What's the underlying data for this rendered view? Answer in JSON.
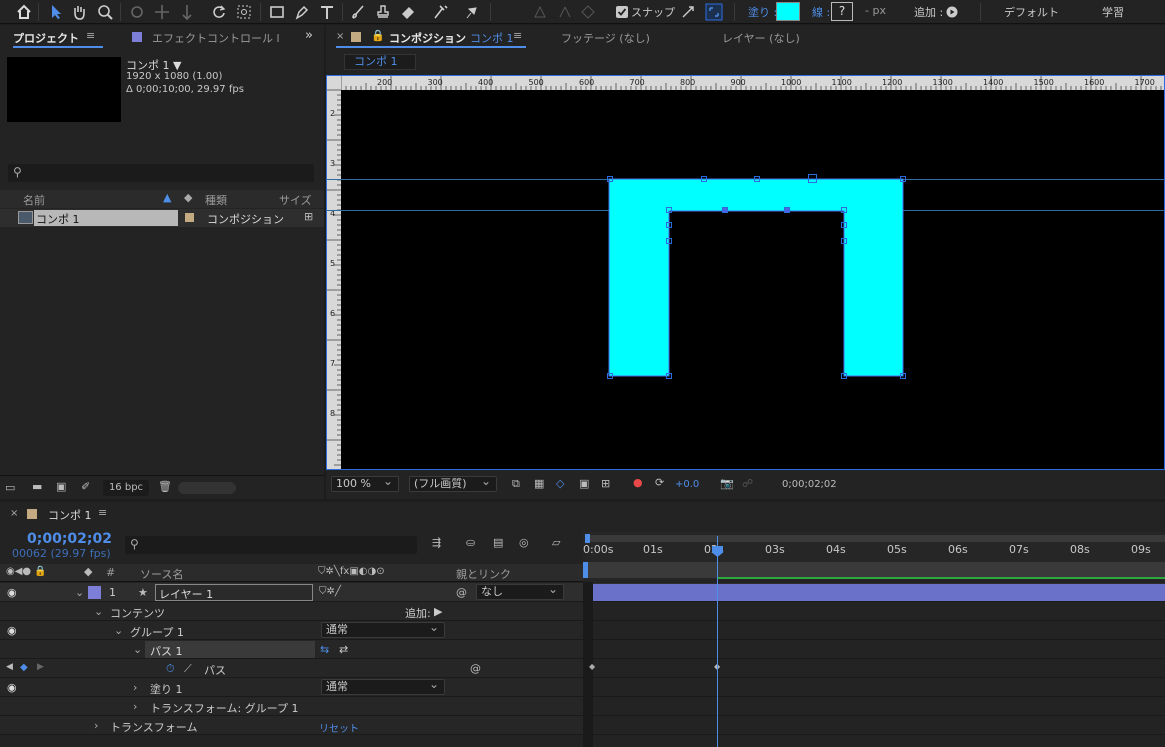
{
  "toolbar": {
    "snap_label": "スナップ",
    "fill_label": "塗り :",
    "stroke_label": "線 :",
    "stroke_value": "?",
    "px_label": "- px",
    "add_label": "追加 :",
    "workspace_default": "デフォルト",
    "workspace_learn": "学習",
    "fill_color": "#00ffff"
  },
  "project_panel": {
    "tab_project": "プロジェクト",
    "tab_effects": "エフェクトコントロール l",
    "comp_name": "コンポ 1 ▼",
    "comp_size": "1920 x 1080 (1.00)",
    "comp_duration": "Δ 0;00;10;00, 29.97 fps",
    "col_name": "名前",
    "col_type": "種類",
    "col_size": "サイズ",
    "items": [
      {
        "name": "コンポ 1",
        "type": "コンポジション"
      }
    ],
    "bpc": "16 bpc"
  },
  "comp_panel": {
    "tab_comp": "コンポジション",
    "tab_comp_name": "コンポ 1",
    "tab_footage": "フッテージ (なし)",
    "tab_layer": "レイヤー (なし)",
    "breadcrumb": "コンポ 1",
    "ruler_labels": [
      "200",
      "300",
      "400",
      "500",
      "600",
      "700",
      "800",
      "900",
      "1000",
      "1100",
      "1200",
      "1300",
      "1400",
      "1500",
      "1600",
      "1700"
    ],
    "vruler_labels": [
      "2",
      "3",
      "4",
      "5",
      "6",
      "7",
      "8"
    ],
    "zoom": "100 %",
    "quality": "(フル画質)",
    "exposure": "+0.0",
    "timecode": "0;00;02;02",
    "shape_color": "#00ffff"
  },
  "timeline": {
    "tab_name": "コンポ 1",
    "timecode": "0;00;02;02",
    "frame_info": "00062 (29.97 fps)",
    "col_source": "ソース名",
    "col_parent": "親とリンク",
    "col_num": "#",
    "ticks": [
      "0:00s",
      "01s",
      "02s",
      "03s",
      "04s",
      "05s",
      "06s",
      "07s",
      "08s",
      "09s"
    ],
    "layers": [
      {
        "num": "1",
        "name": "レイヤー 1",
        "parent": "なし"
      }
    ],
    "rows": {
      "contents": "コンテンツ",
      "add": "追加:",
      "group1": "グループ 1",
      "group1_mode": "通常",
      "path1": "パス 1",
      "path": "パス",
      "fill1": "塗り 1",
      "fill1_mode": "通常",
      "transform_group": "トランスフォーム: グループ 1",
      "transform": "トランスフォーム",
      "reset": "リセット"
    }
  }
}
